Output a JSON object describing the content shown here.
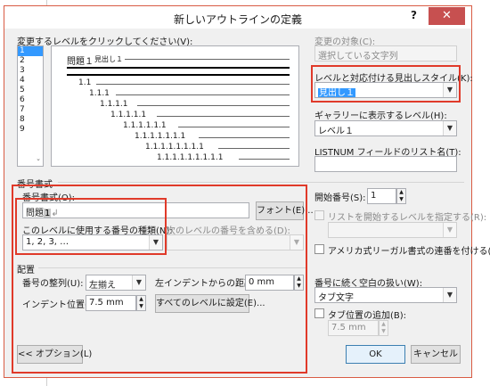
{
  "dialog": {
    "title": "新しいアウトラインの定義",
    "help_label": "?",
    "close_label": "✕"
  },
  "level_list": {
    "label": "変更するレベルをクリックしてください(V):",
    "items": [
      "1",
      "2",
      "3",
      "4",
      "5",
      "6",
      "7",
      "8",
      "9"
    ],
    "selected": "1",
    "scroll_arrow": "⌄"
  },
  "preview": {
    "heading_text": "問題１",
    "heading_style_text": "見出し１",
    "level_texts": [
      "1.1",
      "1.1.1",
      "1.1.1.1",
      "1.1.1.1.1",
      "1.1.1.1.1.1",
      "1.1.1.1.1.1.1",
      "1.1.1.1.1.1.1.1",
      "1.1.1.1.1.1.1.1.1"
    ]
  },
  "right_panel": {
    "apply_to_label": "変更の対象(C):",
    "apply_to_value": "選択している文字列",
    "link_style_label": "レベルと対応付ける見出しスタイル(K):",
    "link_style_value": "見出し１",
    "gallery_level_label": "ギャラリーに表示するレベル(H):",
    "gallery_level_value": "レベル１",
    "listnum_label": "LISTNUM フィールドのリスト名(T):",
    "listnum_value": ""
  },
  "number_format": {
    "section_label": "番号書式",
    "format_label": "番号書式(O):",
    "format_value_prefix": "問題",
    "format_value_number": "1",
    "format_value_suffix": "↲",
    "font_button": "フォント(E)...",
    "style_label": "このレベルに使用する番号の種類(N):",
    "style_value": "1, 2, 3, …",
    "include_label": "次のレベルの番号を含める(D):",
    "include_value": "",
    "start_at_label": "開始番号(S):",
    "start_at_value": "1",
    "restart_label": "リストを開始するレベルを指定する(R):",
    "restart_value": "",
    "legal_label": "アメリカ式リーガル書式の連番を付ける(G)"
  },
  "position": {
    "section_label": "配置",
    "alignment_label": "番号の整列(U):",
    "alignment_value": "左揃え",
    "aligned_at_label": "左インデントからの距離(A):",
    "aligned_at_value": "0 mm",
    "indent_label": "インデント位置(I):",
    "indent_value": "7.5 mm",
    "set_all_button": "すべてのレベルに設定(E)...",
    "follow_label": "番号に続く空白の扱い(W):",
    "follow_value": "タブ文字",
    "tab_stop_label": "タブ位置の追加(B):",
    "tab_stop_value": "7.5 mm"
  },
  "footer": {
    "options_button": "<< オプション(L)",
    "ok_button": "OK",
    "cancel_button": "キャンセル"
  },
  "icons": {
    "combo_arrow": "▼",
    "spin_up": "▲",
    "spin_down": "▼"
  },
  "colors": {
    "highlight_red": "#e03a2a",
    "close_red": "#c75050",
    "selection_blue": "#3399ff"
  }
}
